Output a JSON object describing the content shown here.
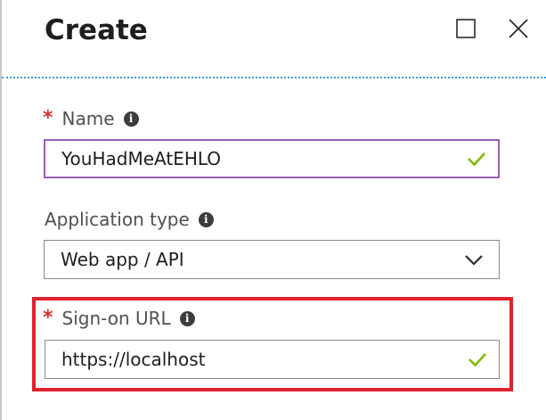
{
  "blade": {
    "title": "Create",
    "icons": {
      "maximize": "maximize-icon",
      "close": "close-icon"
    }
  },
  "form": {
    "name": {
      "label": "Name",
      "required": "*",
      "value": "YouHadMeAtEHLO",
      "status_icon": "checkmark-icon"
    },
    "application_type": {
      "label": "Application type",
      "selected": "Web app / API"
    },
    "sign_on_url": {
      "label": "Sign-on URL",
      "required": "*",
      "value": "https://localhost",
      "status_icon": "checkmark-icon"
    }
  },
  "colors": {
    "required": "#d13438",
    "focus_border": "#9b5fb5",
    "valid_check": "#7fba00",
    "header_divider": "#3aa0d8",
    "highlight": "#e0222e"
  }
}
